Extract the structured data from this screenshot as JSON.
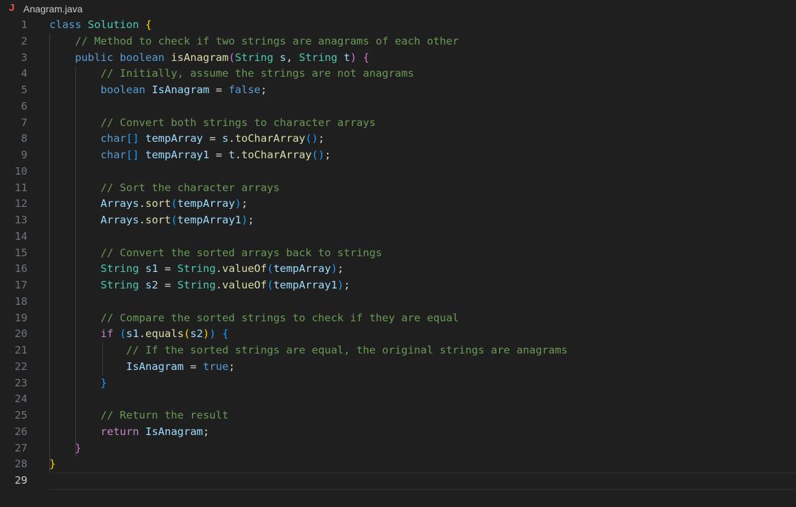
{
  "tab": {
    "icon": "java-file-icon",
    "icon_glyph": "J",
    "file_name": "Anagram.java"
  },
  "editor": {
    "active_line": 29,
    "lines": [
      {
        "n": "1",
        "tokens": [
          [
            "class",
            "kw"
          ],
          [
            " ",
            ""
          ],
          [
            "Solution",
            "cls"
          ],
          [
            " ",
            ""
          ],
          [
            "{",
            "b1"
          ]
        ]
      },
      {
        "n": "2",
        "tokens": [
          [
            "    ",
            ""
          ],
          [
            "// Method to check if two strings are anagrams of each other",
            "cmt"
          ]
        ]
      },
      {
        "n": "3",
        "tokens": [
          [
            "    ",
            ""
          ],
          [
            "public",
            "kw"
          ],
          [
            " ",
            ""
          ],
          [
            "boolean",
            "kw"
          ],
          [
            " ",
            ""
          ],
          [
            "isAnagram",
            "fn"
          ],
          [
            "(",
            "b2"
          ],
          [
            "String",
            "cls"
          ],
          [
            " ",
            ""
          ],
          [
            "s",
            "var"
          ],
          [
            ", ",
            ""
          ],
          [
            "String",
            "cls"
          ],
          [
            " ",
            ""
          ],
          [
            "t",
            "var"
          ],
          [
            ")",
            "b2"
          ],
          [
            " ",
            ""
          ],
          [
            "{",
            "b2"
          ]
        ]
      },
      {
        "n": "4",
        "tokens": [
          [
            "        ",
            ""
          ],
          [
            "// Initially, assume the strings are not anagrams",
            "cmt"
          ]
        ]
      },
      {
        "n": "5",
        "tokens": [
          [
            "        ",
            ""
          ],
          [
            "boolean",
            "kw"
          ],
          [
            " ",
            ""
          ],
          [
            "IsAnagram",
            "var"
          ],
          [
            " = ",
            ""
          ],
          [
            "false",
            "kw"
          ],
          [
            ";",
            ""
          ]
        ]
      },
      {
        "n": "6",
        "tokens": []
      },
      {
        "n": "7",
        "tokens": [
          [
            "        ",
            ""
          ],
          [
            "// Convert both strings to character arrays",
            "cmt"
          ]
        ]
      },
      {
        "n": "8",
        "tokens": [
          [
            "        ",
            ""
          ],
          [
            "char",
            "kw"
          ],
          [
            "[]",
            "b3"
          ],
          [
            " ",
            ""
          ],
          [
            "tempArray",
            "var"
          ],
          [
            " = ",
            ""
          ],
          [
            "s",
            "var"
          ],
          [
            ".",
            ""
          ],
          [
            "toCharArray",
            "fn"
          ],
          [
            "()",
            "b3"
          ],
          [
            ";",
            ""
          ]
        ]
      },
      {
        "n": "9",
        "tokens": [
          [
            "        ",
            ""
          ],
          [
            "char",
            "kw"
          ],
          [
            "[]",
            "b3"
          ],
          [
            " ",
            ""
          ],
          [
            "tempArray1",
            "var"
          ],
          [
            " = ",
            ""
          ],
          [
            "t",
            "var"
          ],
          [
            ".",
            ""
          ],
          [
            "toCharArray",
            "fn"
          ],
          [
            "()",
            "b3"
          ],
          [
            ";",
            ""
          ]
        ]
      },
      {
        "n": "10",
        "tokens": []
      },
      {
        "n": "11",
        "tokens": [
          [
            "        ",
            ""
          ],
          [
            "// Sort the character arrays",
            "cmt"
          ]
        ]
      },
      {
        "n": "12",
        "tokens": [
          [
            "        ",
            ""
          ],
          [
            "Arrays",
            "var"
          ],
          [
            ".",
            ""
          ],
          [
            "sort",
            "fn"
          ],
          [
            "(",
            "b3"
          ],
          [
            "tempArray",
            "var"
          ],
          [
            ")",
            "b3"
          ],
          [
            ";",
            ""
          ]
        ]
      },
      {
        "n": "13",
        "tokens": [
          [
            "        ",
            ""
          ],
          [
            "Arrays",
            "var"
          ],
          [
            ".",
            ""
          ],
          [
            "sort",
            "fn"
          ],
          [
            "(",
            "b3"
          ],
          [
            "tempArray1",
            "var"
          ],
          [
            ")",
            "b3"
          ],
          [
            ";",
            ""
          ]
        ]
      },
      {
        "n": "14",
        "tokens": []
      },
      {
        "n": "15",
        "tokens": [
          [
            "        ",
            ""
          ],
          [
            "// Convert the sorted arrays back to strings",
            "cmt"
          ]
        ]
      },
      {
        "n": "16",
        "tokens": [
          [
            "        ",
            ""
          ],
          [
            "String",
            "cls"
          ],
          [
            " ",
            ""
          ],
          [
            "s1",
            "var"
          ],
          [
            " = ",
            ""
          ],
          [
            "String",
            "cls"
          ],
          [
            ".",
            ""
          ],
          [
            "valueOf",
            "fn"
          ],
          [
            "(",
            "b3"
          ],
          [
            "tempArray",
            "var"
          ],
          [
            ")",
            "b3"
          ],
          [
            ";",
            ""
          ]
        ]
      },
      {
        "n": "17",
        "tokens": [
          [
            "        ",
            ""
          ],
          [
            "String",
            "cls"
          ],
          [
            " ",
            ""
          ],
          [
            "s2",
            "var"
          ],
          [
            " = ",
            ""
          ],
          [
            "String",
            "cls"
          ],
          [
            ".",
            ""
          ],
          [
            "valueOf",
            "fn"
          ],
          [
            "(",
            "b3"
          ],
          [
            "tempArray1",
            "var"
          ],
          [
            ")",
            "b3"
          ],
          [
            ";",
            ""
          ]
        ]
      },
      {
        "n": "18",
        "tokens": []
      },
      {
        "n": "19",
        "tokens": [
          [
            "        ",
            ""
          ],
          [
            "// Compare the sorted strings to check if they are equal",
            "cmt"
          ]
        ]
      },
      {
        "n": "20",
        "tokens": [
          [
            "        ",
            ""
          ],
          [
            "if",
            "ctl"
          ],
          [
            " ",
            ""
          ],
          [
            "(",
            "b3"
          ],
          [
            "s1",
            "var"
          ],
          [
            ".",
            ""
          ],
          [
            "equals",
            "fn"
          ],
          [
            "(",
            "b1"
          ],
          [
            "s2",
            "var"
          ],
          [
            ")",
            "b1"
          ],
          [
            ")",
            "b3"
          ],
          [
            " ",
            ""
          ],
          [
            "{",
            "b3"
          ]
        ]
      },
      {
        "n": "21",
        "tokens": [
          [
            "            ",
            ""
          ],
          [
            "// If the sorted strings are equal, the original strings are anagrams",
            "cmt"
          ]
        ]
      },
      {
        "n": "22",
        "tokens": [
          [
            "            ",
            ""
          ],
          [
            "IsAnagram",
            "var"
          ],
          [
            " = ",
            ""
          ],
          [
            "true",
            "kw"
          ],
          [
            ";",
            ""
          ]
        ]
      },
      {
        "n": "23",
        "tokens": [
          [
            "        ",
            ""
          ],
          [
            "}",
            "b3"
          ]
        ]
      },
      {
        "n": "24",
        "tokens": []
      },
      {
        "n": "25",
        "tokens": [
          [
            "        ",
            ""
          ],
          [
            "// Return the result",
            "cmt"
          ]
        ]
      },
      {
        "n": "26",
        "tokens": [
          [
            "        ",
            ""
          ],
          [
            "return",
            "ctl"
          ],
          [
            " ",
            ""
          ],
          [
            "IsAnagram",
            "var"
          ],
          [
            ";",
            ""
          ]
        ]
      },
      {
        "n": "27",
        "tokens": [
          [
            "    ",
            ""
          ],
          [
            "}",
            "b2"
          ]
        ]
      },
      {
        "n": "28",
        "tokens": [
          [
            "}",
            "b1"
          ]
        ]
      },
      {
        "n": "29",
        "tokens": []
      }
    ]
  },
  "colors": {
    "background": "#1f1f1f",
    "line_number": "#6e7681",
    "line_number_active": "#cccccc",
    "keyword": "#569cd6",
    "control": "#c586c0",
    "class": "#4ec9b0",
    "function": "#dcdcaa",
    "variable": "#9cdcfe",
    "comment": "#6a9955",
    "bracket_1": "#ffd700",
    "bracket_2": "#da70d6",
    "bracket_3": "#179fff",
    "java_icon": "#e0524a"
  }
}
